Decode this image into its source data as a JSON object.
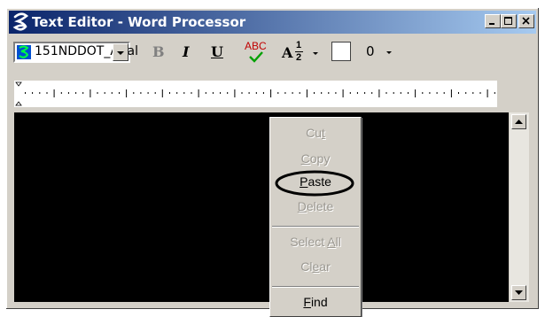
{
  "window": {
    "title": "Text Editor - Word Processor"
  },
  "toolbar": {
    "font_name": "151NDDOT_Arial",
    "bold_label": "B",
    "italic_label": "I",
    "underline_label": "U",
    "spell_label": "ABC",
    "fraction_label": "A",
    "fraction_num": "1",
    "fraction_den": "2",
    "color_value": "0"
  },
  "context_menu": {
    "items": [
      {
        "pre": "Cu",
        "key": "t",
        "post": "",
        "enabled": false
      },
      {
        "pre": "",
        "key": "C",
        "post": "opy",
        "enabled": false
      },
      {
        "pre": "",
        "key": "P",
        "post": "aste",
        "enabled": true
      },
      {
        "pre": "",
        "key": "D",
        "post": "elete",
        "enabled": false
      },
      {
        "pre": "Select ",
        "key": "A",
        "post": "ll",
        "enabled": false
      },
      {
        "pre": "Cl",
        "key": "e",
        "post": "ar",
        "enabled": false
      },
      {
        "pre": "",
        "key": "F",
        "post": "ind",
        "enabled": true
      }
    ]
  },
  "colors": {
    "title_gradient_start": "#0a246a",
    "title_gradient_end": "#a6caf0",
    "window_face": "#d4d0c8",
    "editor_background": "#000000",
    "spell_check_text": "#c00000",
    "spell_check_mark": "#00a000"
  },
  "icons": [
    "app-icon",
    "font-type-icon",
    "dropdown-arrow-icon",
    "minimize-icon",
    "maximize-icon",
    "close-icon",
    "scroll-up-icon",
    "scroll-down-icon"
  ]
}
